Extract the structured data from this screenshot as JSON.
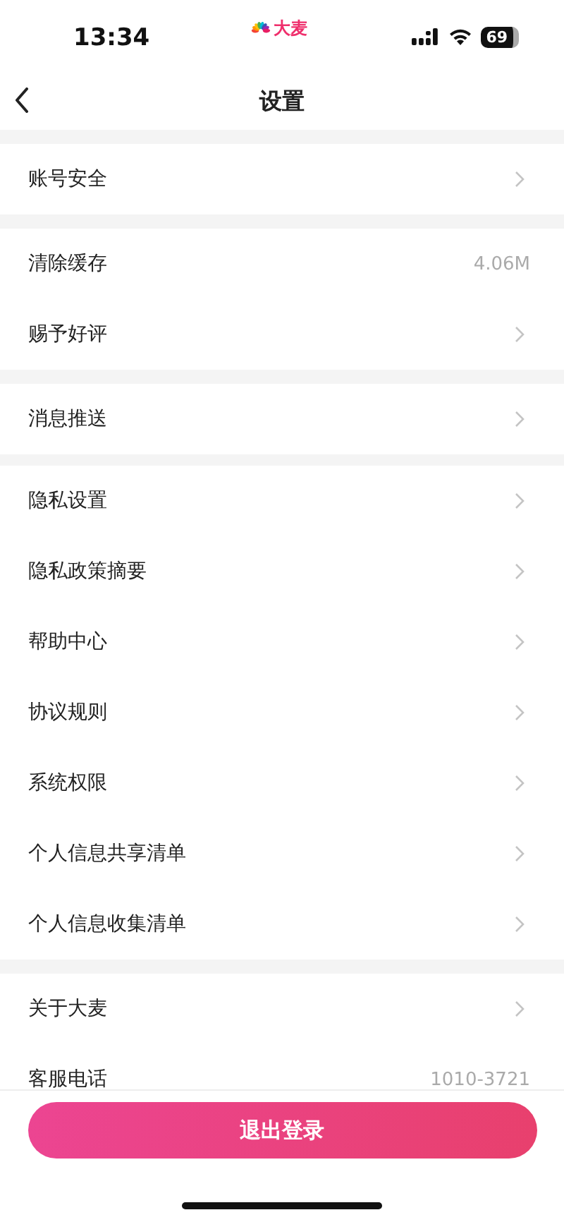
{
  "status_bar": {
    "time": "13:34",
    "app_name": "大麦",
    "battery": "69"
  },
  "nav": {
    "title": "设置"
  },
  "groups": [
    {
      "items": [
        {
          "kind": "link",
          "label": "账号安全"
        }
      ]
    },
    {
      "items": [
        {
          "kind": "value",
          "label": "清除缓存",
          "value": "4.06M"
        },
        {
          "kind": "link",
          "label": "赐予好评"
        }
      ]
    },
    {
      "items": [
        {
          "kind": "link",
          "label": "消息推送"
        }
      ]
    },
    {
      "items": [
        {
          "kind": "link",
          "label": "隐私设置"
        },
        {
          "kind": "link",
          "label": "隐私政策摘要"
        },
        {
          "kind": "link",
          "label": "帮助中心"
        },
        {
          "kind": "link",
          "label": "协议规则"
        },
        {
          "kind": "link",
          "label": "系统权限"
        },
        {
          "kind": "link",
          "label": "个人信息共享清单"
        },
        {
          "kind": "link",
          "label": "个人信息收集清单"
        }
      ]
    },
    {
      "items": [
        {
          "kind": "link",
          "label": "关于大麦"
        },
        {
          "kind": "value",
          "label": "客服电话",
          "value": "1010-3721"
        }
      ]
    }
  ],
  "logout_button": "退出登录"
}
